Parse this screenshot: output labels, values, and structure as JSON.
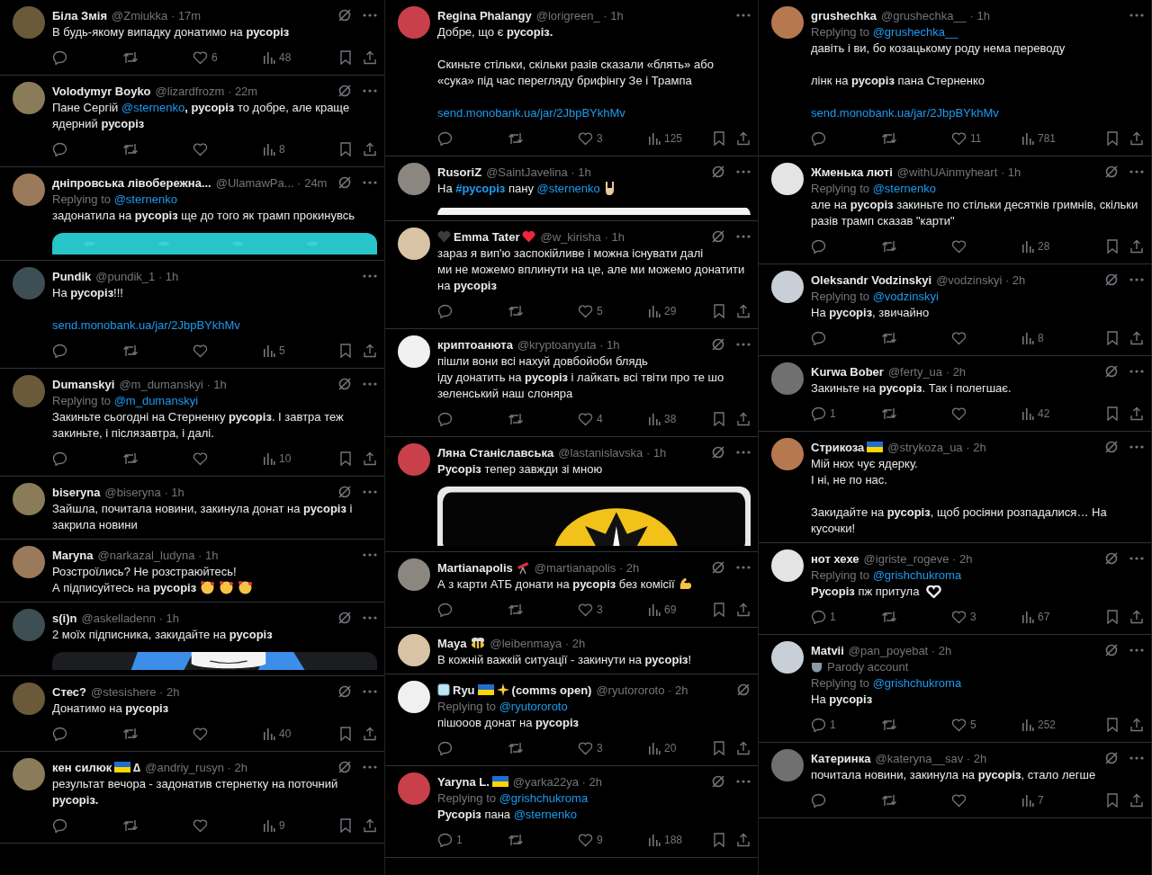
{
  "columns": [
    {
      "tweets": [
        {
          "author": [
            {
              "kind": "text",
              "text": "Біла Змія"
            }
          ],
          "meta": "@Zmiukka · 17m",
          "grok": true,
          "more": true,
          "body": [
            [
              [
                {
                  "kind": "plain",
                  "text": "В будь-якому випадку донатимо на "
                },
                {
                  "kind": "bold",
                  "text": "русоріз"
                }
              ]
            ]
          ],
          "actions": {
            "likes": "6",
            "views": "48"
          }
        },
        {
          "author": [
            {
              "kind": "text",
              "text": "Volodymyr Boyko"
            }
          ],
          "meta": "@lizardfrozm · 22m",
          "grok": true,
          "more": true,
          "body": [
            [
              [
                {
                  "kind": "plain",
                  "text": "Пане Сергій "
                },
                {
                  "kind": "link",
                  "text": "@sternenko"
                },
                {
                  "kind": "bold",
                  "text": ", русоріз"
                },
                {
                  "kind": "plain",
                  "text": " то добре, але краще ядерний "
                },
                {
                  "kind": "bold",
                  "text": "русоріз"
                }
              ]
            ]
          ],
          "actions": {
            "views": "8"
          }
        },
        {
          "author": [
            {
              "kind": "text",
              "text": "дніпровська лівобережна..."
            }
          ],
          "meta": "@UlamawPa... · 24m",
          "grok": true,
          "more": true,
          "replying_to": {
            "label": "Replying to",
            "handle": "@sternenko"
          },
          "body": [
            [
              [
                {
                  "kind": "plain",
                  "text": "задонатила на "
                },
                {
                  "kind": "bold",
                  "text": "русоріз"
                },
                {
                  "kind": "plain",
                  "text": " ще до того як трамп прокинувсь"
                }
              ]
            ]
          ],
          "media": {
            "kind": "picture"
          }
        },
        {
          "author": [
            {
              "kind": "text",
              "text": "Pundik"
            }
          ],
          "meta": "@pundik_1 · 1h",
          "grok": false,
          "more": true,
          "body": [
            [
              [
                {
                  "kind": "plain",
                  "text": "На "
                },
                {
                  "kind": "bold",
                  "text": "русоріз"
                },
                {
                  "kind": "plain",
                  "text": "!!!"
                }
              ]
            ],
            [
              [
                {
                  "kind": "link",
                  "text": "send.monobank.ua/jar/2JbpBYkhMv"
                }
              ]
            ]
          ],
          "actions": {
            "views": "5"
          }
        },
        {
          "author": [
            {
              "kind": "text",
              "text": "Dumanskyi"
            }
          ],
          "meta": "@m_dumanskyi · 1h",
          "grok": true,
          "more": true,
          "replying_to": {
            "label": "Replying to",
            "handle": "@m_dumanskyi"
          },
          "body": [
            [
              [
                {
                  "kind": "plain",
                  "text": "Закиньте сьогодні на Стерненку "
                },
                {
                  "kind": "bold",
                  "text": "русоріз"
                },
                {
                  "kind": "plain",
                  "text": ". І завтра теж закиньте, і післязавтра, і далі."
                }
              ]
            ]
          ],
          "actions": {
            "views": "10"
          }
        },
        {
          "author": [
            {
              "kind": "text",
              "text": "biseryna"
            }
          ],
          "meta": "@biseryna · 1h",
          "grok": true,
          "more": true,
          "body": [
            [
              [
                {
                  "kind": "plain",
                  "text": "Зайшла, почитала новини, закинула донат на "
                },
                {
                  "kind": "bold",
                  "text": "русоріз"
                },
                {
                  "kind": "plain",
                  "text": " і закрила новини"
                }
              ]
            ]
          ]
        },
        {
          "author": [
            {
              "kind": "text",
              "text": "Maryna"
            }
          ],
          "meta": "@narkazal_ludyna · 1h",
          "grok": false,
          "more": true,
          "body": [
            [
              [
                {
                  "kind": "plain",
                  "text": "Розстроїлись? Не розстраюйтесь!"
                }
              ],
              [
                {
                  "kind": "plain",
                  "text": "А підписуйтесь на "
                },
                {
                  "kind": "bold",
                  "text": "русоріз"
                },
                {
                  "kind": "hearts-face"
                },
                {
                  "kind": "hearts-face"
                },
                {
                  "kind": "hearts-face"
                }
              ]
            ]
          ]
        },
        {
          "author": [
            {
              "kind": "text",
              "text": "s(i)n"
            }
          ],
          "meta": "@askelladenn · 1h",
          "grok": true,
          "more": true,
          "body": [
            [
              [
                {
                  "kind": "plain",
                  "text": "2 моїх підписника, закидайте на "
                },
                {
                  "kind": "bold",
                  "text": "русоріз"
                }
              ]
            ]
          ],
          "media": {
            "kind": "picture"
          }
        },
        {
          "author": [
            {
              "kind": "text",
              "text": "Стес?"
            }
          ],
          "meta": "@stesishere · 2h",
          "grok": true,
          "more": true,
          "body": [
            [
              [
                {
                  "kind": "plain",
                  "text": "Донатимо на "
                },
                {
                  "kind": "bold",
                  "text": "русоріз"
                }
              ]
            ]
          ],
          "actions": {
            "views": "40"
          }
        },
        {
          "author": [
            {
              "kind": "text",
              "text": "кен силюк"
            },
            {
              "kind": "flag"
            },
            {
              "kind": "text",
              "text": "∆"
            }
          ],
          "meta": "@andriy_rusyn · 2h",
          "grok": true,
          "more": true,
          "body": [
            [
              [
                {
                  "kind": "plain",
                  "text": "результат вечора - задонатив стернетку на поточний "
                },
                {
                  "kind": "bold",
                  "text": "русоріз."
                }
              ]
            ]
          ],
          "actions": {
            "views": "9"
          }
        }
      ]
    },
    {
      "tweets": [
        {
          "author": [
            {
              "kind": "text",
              "text": "Regina Phalangy"
            }
          ],
          "meta": "@lorigreen_ · 1h",
          "grok": false,
          "more": true,
          "body": [
            [
              [
                {
                  "kind": "plain",
                  "text": "Добре, що є "
                },
                {
                  "kind": "bold",
                  "text": "русоріз."
                }
              ]
            ],
            [
              [
                {
                  "kind": "plain",
                  "text": "Скиньте стільки, скільки разів сказали «блять» або «сука» під час перегляду брифінгу Зе і Трампа"
                }
              ]
            ],
            [
              [
                {
                  "kind": "link",
                  "text": "send.monobank.ua/jar/2JbpBYkhMv"
                }
              ]
            ]
          ],
          "actions": {
            "likes": "3",
            "views": "125"
          }
        },
        {
          "author": [
            {
              "kind": "text",
              "text": "RusoriZ"
            }
          ],
          "meta": "@SaintJavelina · 1h",
          "grok": true,
          "more": true,
          "body": [
            [
              [
                {
                  "kind": "plain",
                  "text": "На "
                },
                {
                  "kind": "tag",
                  "text": "#русоріз"
                },
                {
                  "kind": "plain",
                  "text": " пану "
                },
                {
                  "kind": "link",
                  "text": "@sternenko"
                },
                {
                  "kind": "rock-hand"
                }
              ]
            ]
          ],
          "media": {
            "kind": "picture"
          }
        },
        {
          "author": [
            {
              "kind": "black-heart"
            },
            {
              "kind": "text",
              "text": "Emma Tater"
            },
            {
              "kind": "red-heart"
            }
          ],
          "meta": "@w_kirisha · 1h",
          "grok": true,
          "more": true,
          "body": [
            [
              [
                {
                  "kind": "plain",
                  "text": "зараз я вип'ю заспокійливе і можна існувати далі"
                }
              ],
              [
                {
                  "kind": "plain",
                  "text": "ми не можемо вплинути на це, але ми можемо донатити на "
                },
                {
                  "kind": "bold",
                  "text": "русоріз"
                }
              ]
            ]
          ],
          "actions": {
            "likes": "5",
            "views": "29"
          }
        },
        {
          "author": [
            {
              "kind": "text",
              "text": "криптоанюта"
            }
          ],
          "meta": "@kryptoanyuta · 1h",
          "grok": true,
          "more": true,
          "body": [
            [
              [
                {
                  "kind": "plain",
                  "text": "пішли вони всі нахуй довбойоби блядь"
                }
              ],
              [
                {
                  "kind": "plain",
                  "text": "іду донатить на "
                },
                {
                  "kind": "bold",
                  "text": "русоріз"
                },
                {
                  "kind": "plain",
                  "text": " і лайкать всі твіти про те шо зеленський наш слоняра"
                }
              ]
            ]
          ],
          "actions": {
            "likes": "4",
            "views": "38"
          }
        },
        {
          "author": [
            {
              "kind": "text",
              "text": "Ляна Станіславська"
            }
          ],
          "meta": "@lastanislavska · 1h",
          "grok": true,
          "more": true,
          "body": [
            [
              [
                {
                  "kind": "bold",
                  "text": "Русоріз"
                },
                {
                  "kind": "plain",
                  "text": " тепер завжди зі мною"
                }
              ]
            ]
          ],
          "media": {
            "kind": "picture"
          }
        },
        {
          "author": [
            {
              "kind": "text",
              "text": "Martianapolis"
            },
            {
              "kind": "telescope"
            }
          ],
          "meta": "@martianapolis · 2h",
          "grok": true,
          "more": true,
          "body": [
            [
              [
                {
                  "kind": "plain",
                  "text": "А з карти АТБ донати на "
                },
                {
                  "kind": "bold",
                  "text": "русоріз"
                },
                {
                  "kind": "plain",
                  "text": " без комісії"
                },
                {
                  "kind": "muscle"
                }
              ]
            ]
          ],
          "actions": {
            "likes": "3",
            "views": "69"
          }
        },
        {
          "author": [
            {
              "kind": "text",
              "text": "Maya"
            },
            {
              "kind": "bee"
            }
          ],
          "meta": "@leibenmaya · 2h",
          "grok": false,
          "more": false,
          "body": [
            [
              [
                {
                  "kind": "plain",
                  "text": "В кожній важкій ситуації - закинути на "
                },
                {
                  "kind": "bold",
                  "text": "русоріз"
                },
                {
                  "kind": "plain",
                  "text": "!"
                }
              ]
            ]
          ]
        },
        {
          "author": [
            {
              "kind": "ice"
            },
            {
              "kind": "text",
              "text": "Ryu"
            },
            {
              "kind": "flag"
            },
            {
              "kind": "sparkle"
            },
            {
              "kind": "text",
              "text": "(comms open)"
            }
          ],
          "meta": "@ryutororoto · 2h",
          "grok": true,
          "more": false,
          "replying_to": {
            "label": "Replying to",
            "handle": "@ryutororoto"
          },
          "body": [
            [
              [
                {
                  "kind": "plain",
                  "text": "пішооов донат на "
                },
                {
                  "kind": "bold",
                  "text": "русоріз"
                }
              ]
            ]
          ],
          "actions": {
            "likes": "3",
            "views": "20"
          }
        },
        {
          "author": [
            {
              "kind": "text",
              "text": "Yaryna L."
            },
            {
              "kind": "flag"
            }
          ],
          "meta": "@yarka22ya · 2h",
          "grok": true,
          "more": true,
          "replying_to": {
            "label": "Replying to",
            "handle": "@grishchukroma"
          },
          "body": [
            [
              [
                {
                  "kind": "bold",
                  "text": "Русоріз"
                },
                {
                  "kind": "plain",
                  "text": " пана "
                },
                {
                  "kind": "link",
                  "text": "@sternenko"
                }
              ]
            ]
          ],
          "actions": {
            "replies": "1",
            "likes": "9",
            "views": "188"
          }
        }
      ]
    },
    {
      "tweets": [
        {
          "author": [
            {
              "kind": "text",
              "text": "grushechka"
            }
          ],
          "meta": "@grushechka__ · 1h",
          "grok": false,
          "more": true,
          "replying_to": {
            "label": "Replying to",
            "handle": "@grushechka__"
          },
          "body": [
            [
              [
                {
                  "kind": "plain",
                  "text": "давіть і ви, бо козацькому роду нема переводу"
                }
              ]
            ],
            [
              [
                {
                  "kind": "plain",
                  "text": "лінк на "
                },
                {
                  "kind": "bold",
                  "text": "русоріз"
                },
                {
                  "kind": "plain",
                  "text": " пана Стерненко"
                }
              ]
            ],
            [
              [
                {
                  "kind": "link",
                  "text": "send.monobank.ua/jar/2JbpBYkhMv"
                }
              ]
            ]
          ],
          "actions": {
            "likes": "11",
            "views": "781"
          }
        },
        {
          "author": [
            {
              "kind": "text",
              "text": "Жменька люті"
            }
          ],
          "meta": "@withUAinmyheart · 1h",
          "grok": true,
          "more": true,
          "replying_to": {
            "label": "Replying to",
            "handle": "@sternenko"
          },
          "body": [
            [
              [
                {
                  "kind": "plain",
                  "text": "але на "
                },
                {
                  "kind": "bold",
                  "text": "русоріз"
                },
                {
                  "kind": "plain",
                  "text": " закиньте по стільки десятків гримнів, скільки разів трамп сказав \"карти\""
                }
              ]
            ]
          ],
          "actions": {
            "views": "28"
          }
        },
        {
          "author": [
            {
              "kind": "text",
              "text": "Oleksandr Vodzinskyi"
            }
          ],
          "meta": "@vodzinskyi · 2h",
          "grok": true,
          "more": true,
          "replying_to": {
            "label": "Replying to",
            "handle": "@vodzinskyi"
          },
          "body": [
            [
              [
                {
                  "kind": "plain",
                  "text": "На "
                },
                {
                  "kind": "bold",
                  "text": "русоріз"
                },
                {
                  "kind": "plain",
                  "text": ", звичайно"
                }
              ]
            ]
          ],
          "actions": {
            "views": "8"
          }
        },
        {
          "author": [
            {
              "kind": "text",
              "text": "Kurwa Bober"
            }
          ],
          "meta": "@ferty_ua · 2h",
          "grok": true,
          "more": true,
          "body": [
            [
              [
                {
                  "kind": "plain",
                  "text": "Закиньте на "
                },
                {
                  "kind": "bold",
                  "text": "русоріз"
                },
                {
                  "kind": "plain",
                  "text": ". Так і полегшає."
                }
              ]
            ]
          ],
          "actions": {
            "replies": "1",
            "views": "42"
          }
        },
        {
          "author": [
            {
              "kind": "text",
              "text": "Стрикоза"
            },
            {
              "kind": "flag"
            }
          ],
          "meta": "@strykoza_ua · 2h",
          "grok": true,
          "more": true,
          "body": [
            [
              [
                {
                  "kind": "plain",
                  "text": "Мій нюх чує ядерку."
                }
              ],
              [
                {
                  "kind": "plain",
                  "text": "І ні, не по нас."
                }
              ]
            ],
            [
              [
                {
                  "kind": "plain",
                  "text": "Закидайте на "
                },
                {
                  "kind": "bold",
                  "text": "русоріз"
                },
                {
                  "kind": "plain",
                  "text": ", щоб росіяни розпадалися… На кусочки!"
                }
              ]
            ]
          ]
        },
        {
          "author": [
            {
              "kind": "text",
              "text": "нот хехе"
            }
          ],
          "meta": "@igriste_rogeve · 2h",
          "grok": true,
          "more": true,
          "replying_to": {
            "label": "Replying to",
            "handle": "@grishchukroma"
          },
          "body": [
            [
              [
                {
                  "kind": "bold",
                  "text": "Русоріз"
                },
                {
                  "kind": "plain",
                  "text": " пж притула "
                },
                {
                  "kind": "heart-hands"
                }
              ]
            ]
          ],
          "actions": {
            "replies": "1",
            "likes": "3",
            "views": "67"
          }
        },
        {
          "author": [
            {
              "kind": "text",
              "text": "Matvii"
            }
          ],
          "meta": "@pan_poyebat · 2h",
          "grok": true,
          "more": true,
          "parody": "Parody account",
          "replying_to": {
            "label": "Replying to",
            "handle": "@grishchukroma"
          },
          "body": [
            [
              [
                {
                  "kind": "plain",
                  "text": "На "
                },
                {
                  "kind": "bold",
                  "text": "русоріз"
                }
              ]
            ]
          ],
          "actions": {
            "replies": "1",
            "likes": "5",
            "views": "252"
          }
        },
        {
          "author": [
            {
              "kind": "text",
              "text": "Катеринка"
            }
          ],
          "meta": "@kateryna__sav · 2h",
          "grok": true,
          "more": true,
          "body": [
            [
              [
                {
                  "kind": "plain",
                  "text": "почитала новини, закинула на "
                },
                {
                  "kind": "bold",
                  "text": "русоріз"
                },
                {
                  "kind": "plain",
                  "text": ", стало легше"
                }
              ]
            ]
          ],
          "actions": {
            "views": "7"
          }
        }
      ]
    }
  ]
}
